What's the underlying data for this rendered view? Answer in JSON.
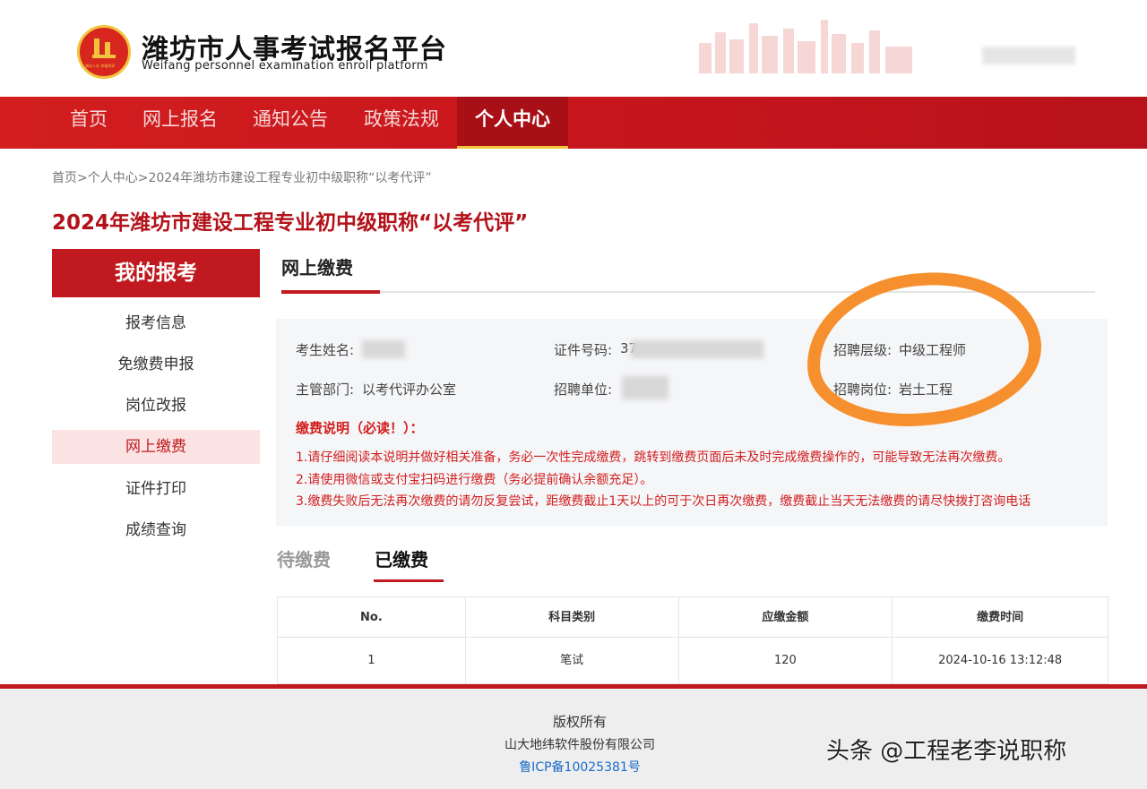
{
  "header": {
    "site_title": "潍坊市人事考试报名平台",
    "site_subtitle": "Weifang personnel examination enroll platform",
    "logo_caption": "潍坊人社 幸福到家"
  },
  "nav": {
    "items": [
      "首页",
      "网上报名",
      "通知公告",
      "政策法规",
      "个人中心"
    ],
    "active": "个人中心"
  },
  "breadcrumb": "首页>个人中心>2024年潍坊市建设工程专业初中级职称“以考代评”",
  "page_heading": "2024年潍坊市建设工程专业初中级职称“以考代评”",
  "sidebar": {
    "title": "我的报考",
    "items": [
      "报考信息",
      "免缴费申报",
      "岗位改报",
      "网上缴费",
      "证件打印",
      "成绩查询"
    ],
    "active": "网上缴费"
  },
  "panel": {
    "title": "网上缴费",
    "info": {
      "name_label": "考生姓名:",
      "name_value": "",
      "id_label": "证件号码:",
      "id_value": "37",
      "level_label": "招聘层级:",
      "level_value": "中级工程师",
      "dept_label": "主管部门:",
      "dept_value": "以考代评办公室",
      "unit_label": "招聘单位:",
      "unit_value": "",
      "post_label": "招聘岗位:",
      "post_value": "岩土工程"
    },
    "notice_title": "缴费说明（必读！）：",
    "notice_lines": [
      "1.请仔细阅读本说明并做好相关准备，务必一次性完成缴费，跳转到缴费页面后未及时完成缴费操作的，可能导致无法再次缴费。",
      "2.请使用微信或支付宝扫码进行缴费（务必提前确认余额充足）。",
      "3.缴费失败后无法再次缴费的请勿反复尝试，距缴费截止1天以上的可于次日再次缴费，缴费截止当天无法缴费的请尽快拨打咨询电话"
    ]
  },
  "sub_tabs": {
    "unpaid": "待缴费",
    "paid": "已缴费",
    "active": "已缴费"
  },
  "table": {
    "headers": [
      "No.",
      "科目类别",
      "应缴金额",
      "缴费时间"
    ],
    "rows": [
      [
        "1",
        "笔试",
        "120",
        "2024-10-16 13:12:48"
      ]
    ]
  },
  "footer": {
    "copyright": "版权所有",
    "company": "山大地纬软件股份有限公司",
    "icp": "鲁ICP备10025381号"
  },
  "watermark": "头条 @工程老李说职称",
  "colors": {
    "brand_red": "#c01a20",
    "highlight_orange": "#f6902e",
    "icp_blue": "#1b6ac9"
  }
}
